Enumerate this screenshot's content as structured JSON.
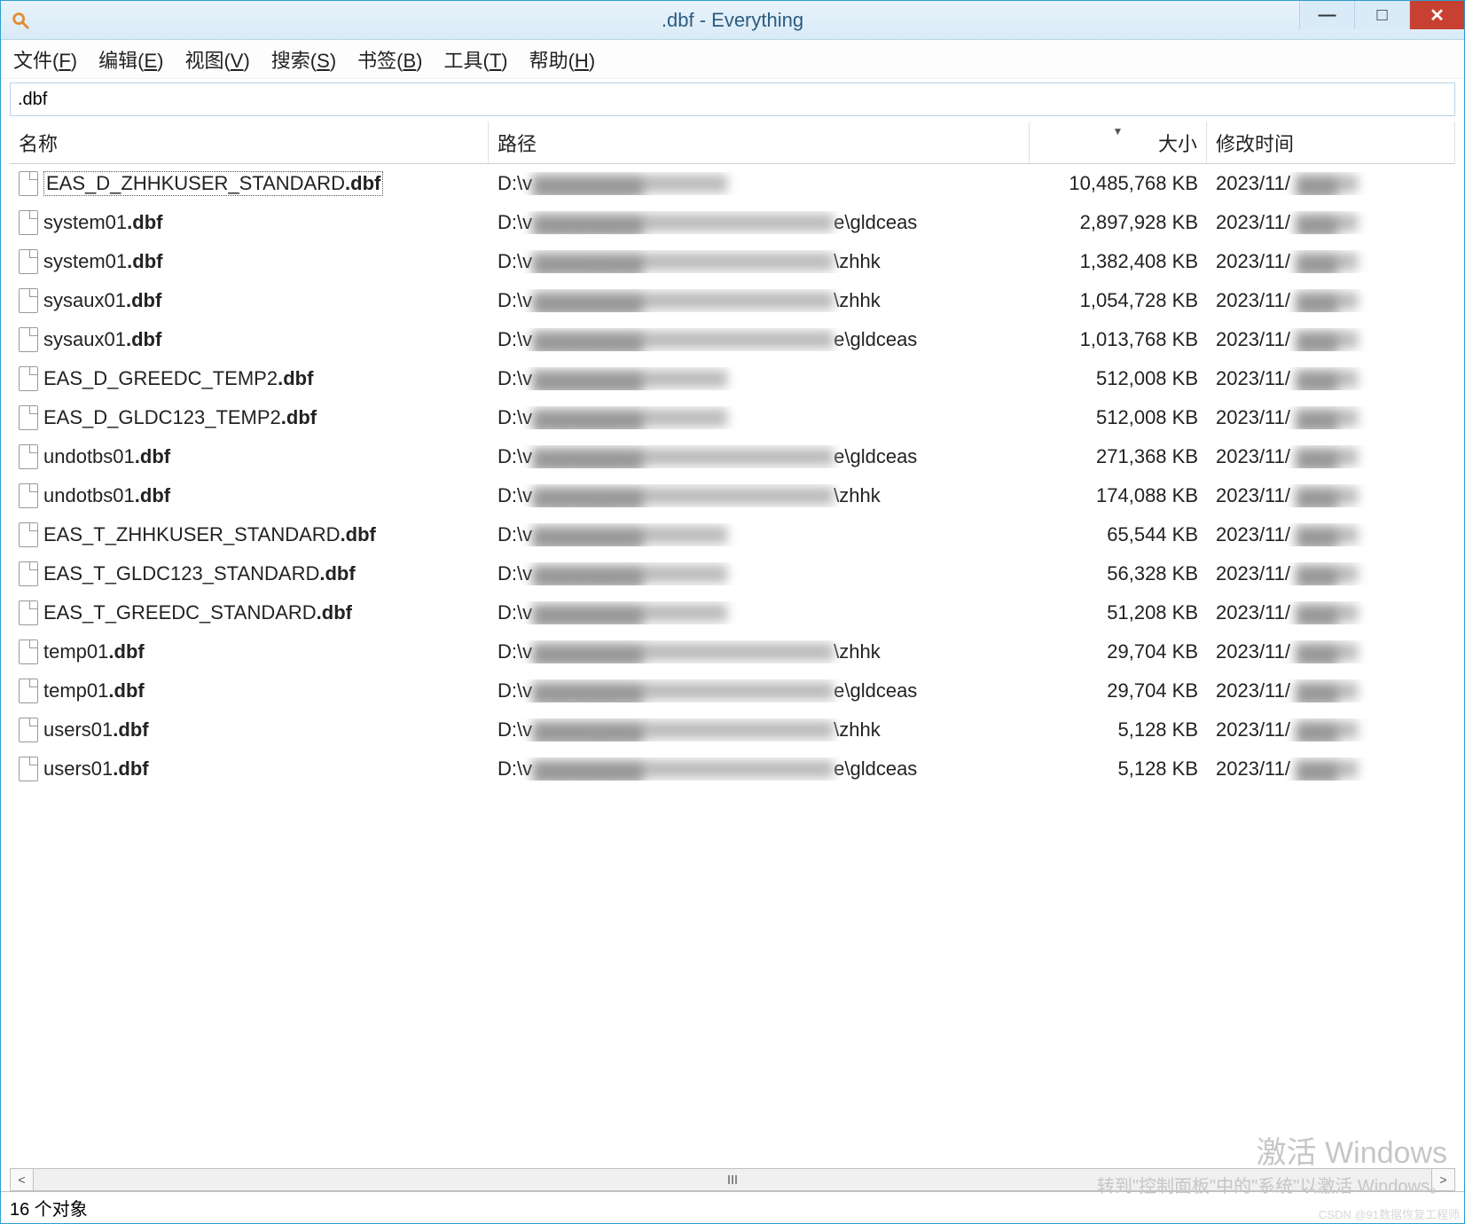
{
  "window": {
    "title": ".dbf - Everything"
  },
  "menu": {
    "file": "文件(",
    "file_key": "F",
    "file_end": ")",
    "edit": "编辑(",
    "edit_key": "E",
    "edit_end": ")",
    "view": "视图(",
    "view_key": "V",
    "view_end": ")",
    "search": "搜索(",
    "search_key": "S",
    "search_end": ")",
    "bookmarks": "书签(",
    "bookmarks_key": "B",
    "bookmarks_end": ")",
    "tools": "工具(",
    "tools_key": "T",
    "tools_end": ")",
    "help": "帮助(",
    "help_key": "H",
    "help_end": ")"
  },
  "search_value": ".dbf",
  "columns": {
    "name": "名称",
    "path": "路径",
    "size": "大小",
    "date": "修改时间"
  },
  "files": [
    {
      "name_prefix": "EAS_D_ZHHKUSER_STANDARD",
      "ext": ".dbf",
      "path_prefix": "D:\\v",
      "path_suffix": "",
      "size": "10,485,768 KB",
      "date": "2023/11/",
      "selected": true
    },
    {
      "name_prefix": "system01",
      "ext": ".dbf",
      "path_prefix": "D:\\v",
      "path_suffix": "e\\gldceas",
      "size": "2,897,928 KB",
      "date": "2023/11/"
    },
    {
      "name_prefix": "system01",
      "ext": ".dbf",
      "path_prefix": "D:\\v",
      "path_suffix": "\\zhhk",
      "size": "1,382,408 KB",
      "date": "2023/11/"
    },
    {
      "name_prefix": "sysaux01",
      "ext": ".dbf",
      "path_prefix": "D:\\v",
      "path_suffix": "\\zhhk",
      "size": "1,054,728 KB",
      "date": "2023/11/"
    },
    {
      "name_prefix": "sysaux01",
      "ext": ".dbf",
      "path_prefix": "D:\\v",
      "path_suffix": "e\\gldceas",
      "size": "1,013,768 KB",
      "date": "2023/11/"
    },
    {
      "name_prefix": "EAS_D_GREEDC_TEMP2",
      "ext": ".dbf",
      "path_prefix": "D:\\v",
      "path_suffix": "",
      "size": "512,008 KB",
      "date": "2023/11/"
    },
    {
      "name_prefix": "EAS_D_GLDC123_TEMP2",
      "ext": ".dbf",
      "path_prefix": "D:\\v",
      "path_suffix": "",
      "size": "512,008 KB",
      "date": "2023/11/"
    },
    {
      "name_prefix": "undotbs01",
      "ext": ".dbf",
      "path_prefix": "D:\\v",
      "path_suffix": "e\\gldceas",
      "size": "271,368 KB",
      "date": "2023/11/"
    },
    {
      "name_prefix": "undotbs01",
      "ext": ".dbf",
      "path_prefix": "D:\\v",
      "path_suffix": "\\zhhk",
      "size": "174,088 KB",
      "date": "2023/11/"
    },
    {
      "name_prefix": "EAS_T_ZHHKUSER_STANDARD",
      "ext": ".dbf",
      "path_prefix": "D:\\v",
      "path_suffix": "",
      "size": "65,544 KB",
      "date": "2023/11/"
    },
    {
      "name_prefix": "EAS_T_GLDC123_STANDARD",
      "ext": ".dbf",
      "path_prefix": "D:\\v",
      "path_suffix": "",
      "size": "56,328 KB",
      "date": "2023/11/"
    },
    {
      "name_prefix": "EAS_T_GREEDC_STANDARD",
      "ext": ".dbf",
      "path_prefix": "D:\\v",
      "path_suffix": "",
      "size": "51,208 KB",
      "date": "2023/11/"
    },
    {
      "name_prefix": "temp01",
      "ext": ".dbf",
      "path_prefix": "D:\\v",
      "path_suffix": "\\zhhk",
      "size": "29,704 KB",
      "date": "2023/11/"
    },
    {
      "name_prefix": "temp01",
      "ext": ".dbf",
      "path_prefix": "D:\\v",
      "path_suffix": "e\\gldceas",
      "size": "29,704 KB",
      "date": "2023/11/"
    },
    {
      "name_prefix": "users01",
      "ext": ".dbf",
      "path_prefix": "D:\\v",
      "path_suffix": "\\zhhk",
      "size": "5,128 KB",
      "date": "2023/11/"
    },
    {
      "name_prefix": "users01",
      "ext": ".dbf",
      "path_prefix": "D:\\v",
      "path_suffix": "e\\gldceas",
      "size": "5,128 KB",
      "date": "2023/11/"
    }
  ],
  "status": "16 个对象",
  "watermark": {
    "line1": "激活 Windows",
    "line2": "转到\"控制面板\"中的\"系统\"以激活 Windows。"
  },
  "csdn": "CSDN @91数据恢复工程师"
}
